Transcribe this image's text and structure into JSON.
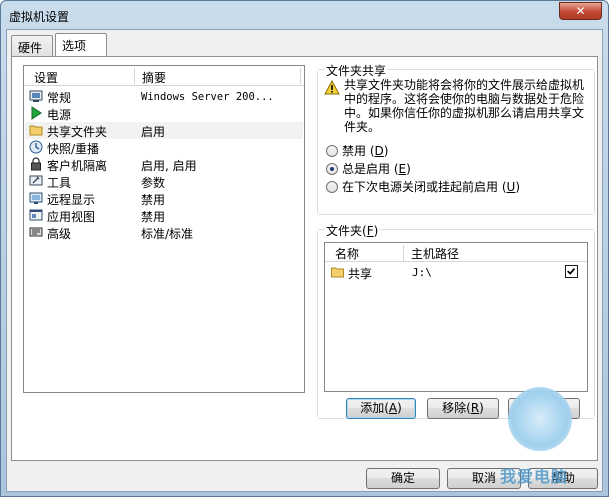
{
  "window": {
    "title": "虚拟机设置",
    "close_symbol": "✕"
  },
  "tabs": [
    {
      "label": "硬件",
      "active": false
    },
    {
      "label": "选项",
      "active": true
    }
  ],
  "settings_list": {
    "col_settings": "设置",
    "col_summary": "摘要",
    "rows": [
      {
        "name": "常规",
        "summary": "Windows Server 200...",
        "icon": "general-icon",
        "selected": false
      },
      {
        "name": "电源",
        "summary": "",
        "icon": "power-play-icon",
        "selected": false
      },
      {
        "name": "共享文件夹",
        "summary": "启用",
        "icon": "folder-icon",
        "selected": true
      },
      {
        "name": "快照/重播",
        "summary": "",
        "icon": "snapshot-icon",
        "selected": false
      },
      {
        "name": "客户机隔离",
        "summary": "启用, 启用",
        "icon": "lock-icon",
        "selected": false
      },
      {
        "name": "工具",
        "summary": "参数",
        "icon": "tools-icon",
        "selected": false
      },
      {
        "name": "远程显示",
        "summary": "禁用",
        "icon": "remote-display-icon",
        "selected": false
      },
      {
        "name": "应用视图",
        "summary": "禁用",
        "icon": "app-view-icon",
        "selected": false
      },
      {
        "name": "高级",
        "summary": "标准/标准",
        "icon": "advanced-icon",
        "selected": false
      }
    ]
  },
  "folder_sharing": {
    "title": "文件夹共享",
    "warning": "共享文件夹功能将会将你的文件展示给虚拟机中的程序。这将会使你的电脑与数据处于危险中。如果你信任你的虚拟机那么请启用共享文件夹。",
    "options": [
      {
        "label": "禁用",
        "key": "D",
        "checked": false
      },
      {
        "label": "总是启用",
        "key": "E",
        "checked": true
      },
      {
        "label": "在下次电源关闭或挂起前启用",
        "key": "U",
        "checked": false
      }
    ]
  },
  "folders": {
    "title": "文件夹",
    "title_key": "F",
    "col_name": "名称",
    "col_host_path": "主机路径",
    "rows": [
      {
        "name": "共享",
        "host_path": "J:\\",
        "enabled": true
      }
    ],
    "buttons": {
      "add": {
        "label": "添加",
        "key": "A"
      },
      "remove": {
        "label": "移除",
        "key": "R"
      },
      "properties": {
        "label": "属性",
        "key": "P"
      }
    }
  },
  "footer": {
    "ok": "确定",
    "cancel": "取消",
    "help": "帮助"
  },
  "watermark": {
    "text": "我爱电脑"
  },
  "colors": {
    "title_bar": "#aac5dc",
    "close_button": "#c24a32",
    "selected_row": "#f2f2f2",
    "warning_yellow": "#f5d33a"
  }
}
